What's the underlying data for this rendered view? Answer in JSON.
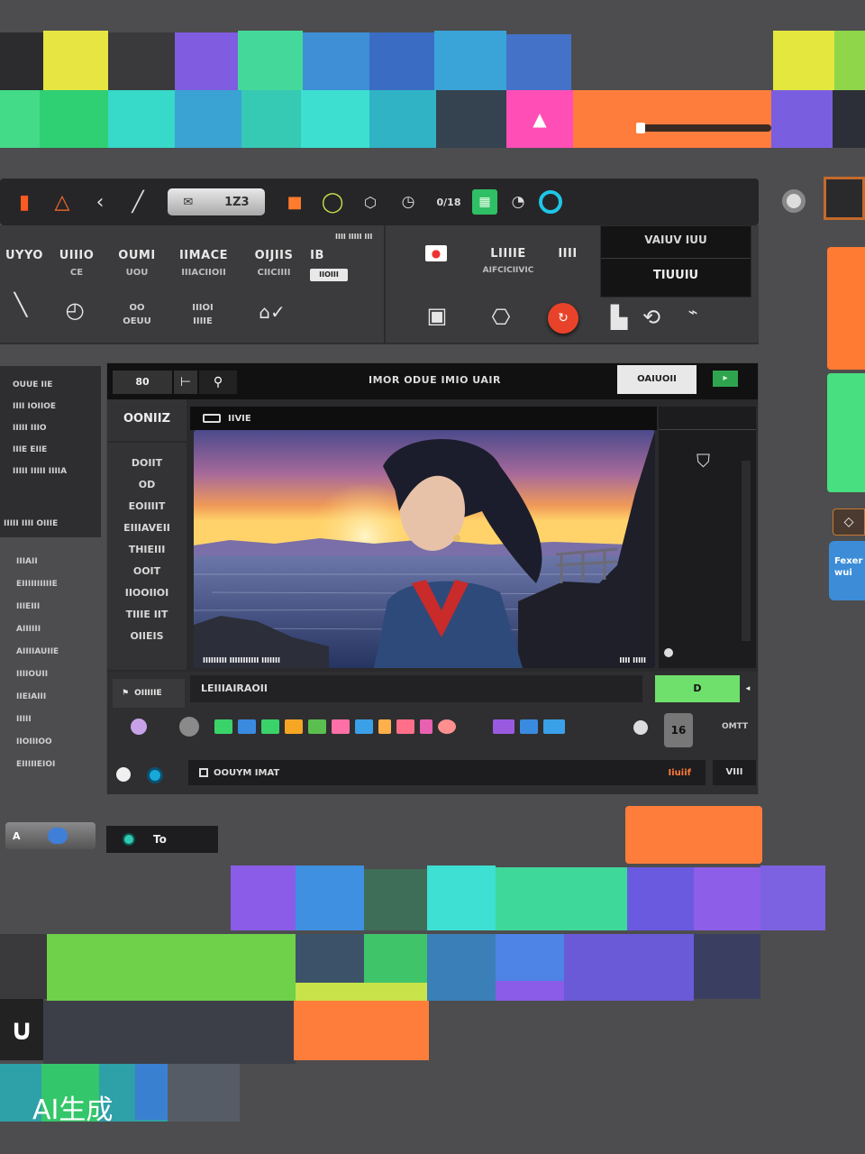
{
  "colors": {
    "background": "#4d4d4f",
    "accent_orange": "#ff7b3a",
    "accent_green": "#6ce26d",
    "accent_cyan": "#35d8d0",
    "accent_purple": "#8b62e8",
    "accent_yellow": "#e7e83d",
    "accent_pink": "#ff4fb8"
  },
  "toolbar": {
    "pill_label": "1Z3",
    "counter_label": "0/18",
    "icons": [
      "stop-icon",
      "warning-triangle-icon",
      "back-chevron-icon",
      "pen-line-icon",
      "mail-icon",
      "record-icon",
      "loop-icon",
      "shield-icon",
      "clock-icon",
      "grid-icon",
      "timer-icon",
      "circle-icon"
    ]
  },
  "properties": {
    "headings": [
      {
        "title": "UYYO",
        "sub": ""
      },
      {
        "title": "UIIIO",
        "sub": "CE"
      },
      {
        "title": "OUMI",
        "sub": "UOU"
      },
      {
        "title": "IIMACE",
        "sub": "IIIACIIOII"
      },
      {
        "title": "OIJIIS",
        "sub": "CIICIIII"
      },
      {
        "title": "IB",
        "sub": ""
      }
    ],
    "row2": [
      {
        "label": "OO",
        "sub": "OEUU"
      },
      {
        "label": "IIIOI",
        "sub": "IIIIE"
      }
    ],
    "badge": "IIOIII",
    "right_headings": [
      {
        "title": "LIIIIE",
        "sub": "AIFCICIIVIC"
      },
      {
        "title": "IIII",
        "sub": ""
      }
    ],
    "top_caption": "IIII IIIII III"
  },
  "value_box": {
    "line1": "VAIUV IUU",
    "line2": "TIUUIU"
  },
  "left_panel": {
    "items": [
      "OUUE IIE",
      "IIII IOIIOE",
      "IIIII IIIO",
      "IIIE EIIE",
      "IIIII IIIII IIIIA"
    ],
    "footer": "IIIII IIII OIIIE"
  },
  "left_list": [
    "IIIAII",
    "EIIIIIIIIIIE",
    "IIIEIII",
    "AIIIIII",
    "AIIIIAUIIE",
    "IIIIOUII",
    "IIEIAIII",
    "IIIII",
    "IIOIIIOO",
    "EIIIIIEIOI"
  ],
  "editor": {
    "tab_number": "80",
    "title": "IMOR ODUE IMIO UAIR",
    "primary_button": "OAIUOII",
    "panel_title": "OONIIZ",
    "side_items": [
      "DOIIT",
      "OD",
      "EOIIIIT",
      "EIIIAVEII",
      "THIEIII",
      "OOIT",
      "IIOOIIOI",
      "TIIIE IIT",
      "OIIEIS"
    ],
    "canvas_label": "IIVIE",
    "image_caption": "IIIIIIIII IIIIIIIIIII IIIIIII",
    "image_counter": "IIII IIIII",
    "status_label": "OIIIIIE",
    "layer_name": "LEIIIAIRAOII",
    "play_label": "D",
    "side_label": "OMTT",
    "count_badge": "16",
    "format_label": "OOUYM IMAT",
    "format_value": "Iiuiif",
    "end_label": "VIII"
  },
  "bottom_controls": {
    "toggle_label": "A",
    "field_label": "To"
  },
  "right_card": {
    "label": "Fexer wui"
  },
  "watermark": "AI生成"
}
